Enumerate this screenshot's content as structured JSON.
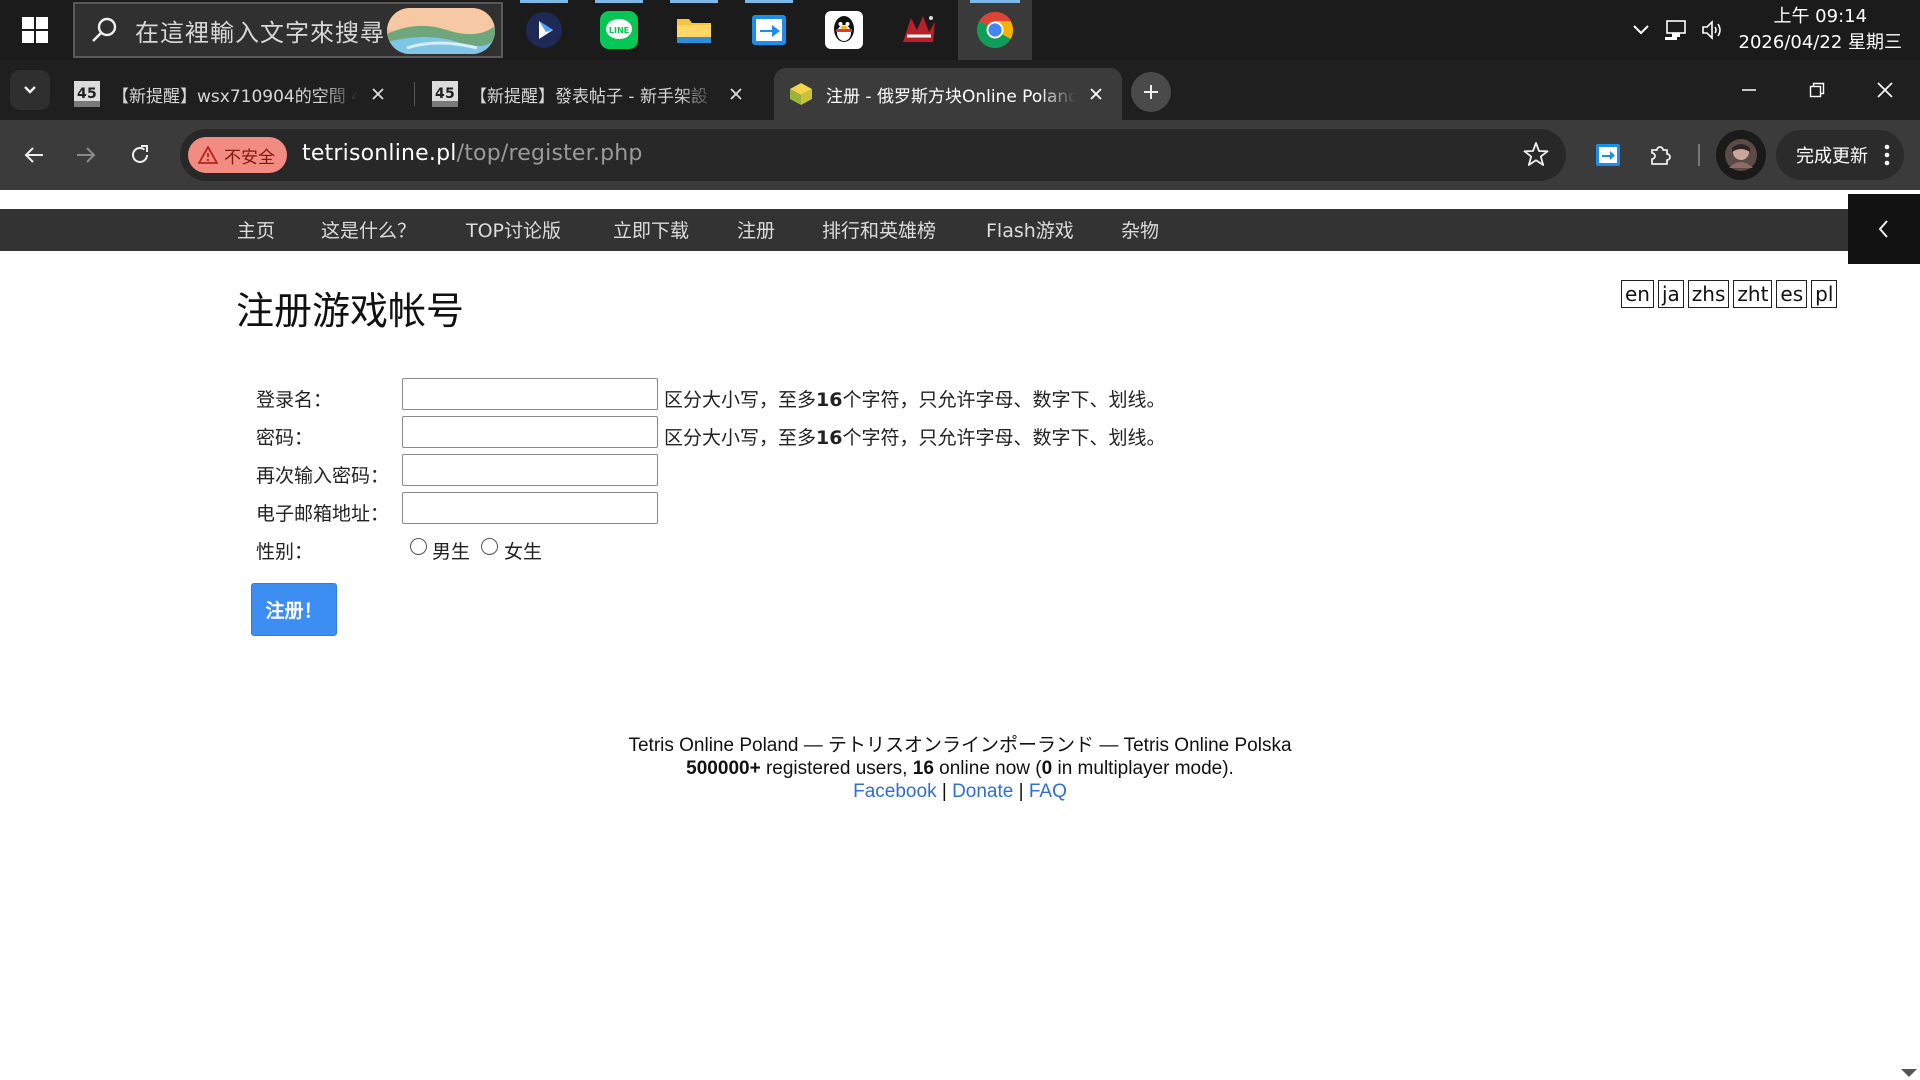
{
  "taskbar": {
    "search_placeholder": "在這裡輸入文字來搜尋",
    "clock_time": "上午 09:14",
    "clock_date": "2026/04/22 星期三"
  },
  "tabs": [
    {
      "title": "【新提醒】wsx710904的空間 4",
      "active": false
    },
    {
      "title": "【新提醒】發表帖子 - 新手架設",
      "active": false
    },
    {
      "title": "注册 - 俄罗斯方块Online Poland",
      "active": true
    }
  ],
  "toolbar": {
    "insecure_label": "不安全",
    "url_host": "tetrisonline.pl",
    "url_path": "/top/register.php",
    "update_label": "完成更新"
  },
  "site_nav": [
    "主页",
    "这是什么？",
    "TOP讨论版",
    "立即下载",
    "注册",
    "排行和英雄榜",
    "Flash游戏",
    "杂物"
  ],
  "page": {
    "title": "注册游戏帐号",
    "languages": [
      "en",
      "ja",
      "zhs",
      "zht",
      "es",
      "pl"
    ]
  },
  "form": {
    "login_label": "登录名：",
    "login_value": "",
    "password_label": "密码：",
    "password_value": "",
    "password2_label": "再次输入密码：",
    "password2_value": "",
    "email_label": "电子邮箱地址：",
    "email_value": "",
    "gender_label": "性别：",
    "male_label": "男生",
    "female_label": "女生",
    "hint_prefix": "区分大小写，至多",
    "hint_number": "16",
    "hint_suffix": "个字符，只允许字母、数字下、划线。",
    "submit_label": "注册！"
  },
  "footer": {
    "line1": "Tetris Online Poland — テトリスオンラインポーランド — Tetris Online Polska",
    "users_count": "500000+",
    "users_text": " registered users, ",
    "online_count": "16",
    "online_text": " online now (",
    "multi_count": "0",
    "multi_text": " in multiplayer mode).",
    "links": [
      "Facebook",
      "Donate",
      "FAQ"
    ],
    "separator": "|"
  }
}
